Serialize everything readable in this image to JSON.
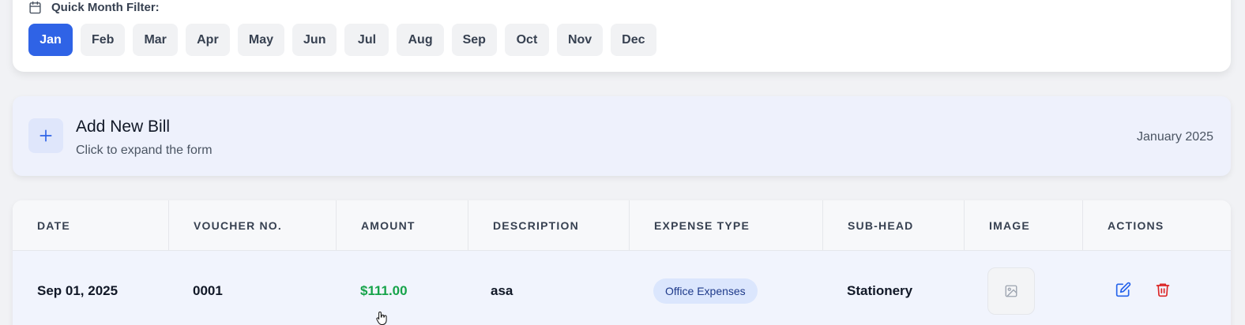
{
  "filter": {
    "title": "Quick Month Filter:",
    "icon": "calendar-icon",
    "months": [
      "Jan",
      "Feb",
      "Mar",
      "Apr",
      "May",
      "Jun",
      "Jul",
      "Aug",
      "Sep",
      "Oct",
      "Nov",
      "Dec"
    ],
    "active": "Jan"
  },
  "add_bill": {
    "icon": "plus-icon",
    "title": "Add New Bill",
    "subtitle": "Click to expand the form",
    "period": "January 2025"
  },
  "table": {
    "headers": [
      "DATE",
      "VOUCHER NO.",
      "AMOUNT",
      "DESCRIPTION",
      "EXPENSE TYPE",
      "SUB-HEAD",
      "IMAGE",
      "ACTIONS"
    ],
    "rows": [
      {
        "date": "Sep 01, 2025",
        "voucher": "0001",
        "amount": "$111.00",
        "description": "asa",
        "expense_type": "Office Expenses",
        "sub_head": "Stationery",
        "image": "image-placeholder-icon",
        "actions": [
          "edit-icon",
          "trash-icon"
        ]
      }
    ]
  },
  "colors": {
    "accent": "#2f63e6",
    "amount": "#16a34a",
    "delete": "#dc2626",
    "edit": "#2563eb"
  }
}
